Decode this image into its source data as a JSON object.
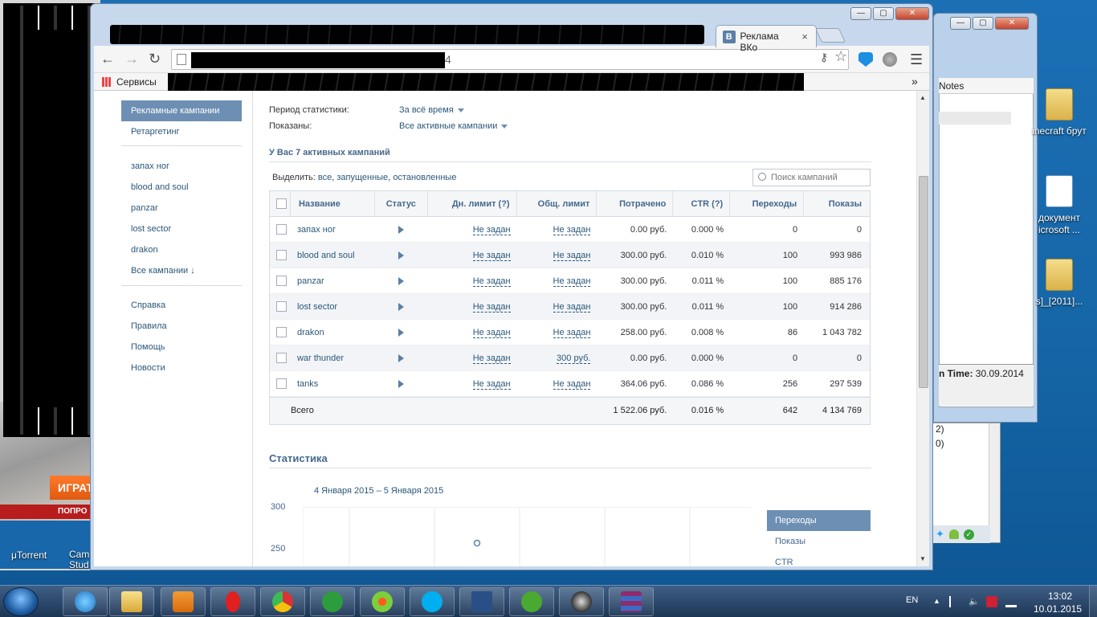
{
  "browser": {
    "active_tab_title": "Реклама ВКо",
    "address_suffix": "4",
    "bookmarks_label": "Сервисы",
    "bookmarks_more": "»"
  },
  "sidebar": {
    "main": [
      {
        "label": "Рекламные кампании",
        "active": true
      },
      {
        "label": "Ретаргетинг",
        "active": false
      }
    ],
    "campaigns": [
      "запах ног",
      "blood and soul",
      "panzar",
      "lost sector",
      "drakon",
      "Все кампании ↓"
    ],
    "help": [
      "Справка",
      "Правила",
      "Помощь",
      "Новости"
    ]
  },
  "filters": {
    "period_label": "Период статистики:",
    "period_value": "За всё время",
    "shown_label": "Показаны:",
    "shown_value": "Все активные кампании"
  },
  "campaigns_heading": "У Вас 7 активных кампаний",
  "select_line": {
    "prefix": "Выделить:",
    "all": "все",
    "running": "запущенные",
    "stopped": "остановленные"
  },
  "search_placeholder": "Поиск кампаний",
  "table": {
    "headers": [
      "Название",
      "Статус",
      "Дн. лимит (?)",
      "Общ. лимит",
      "Потрачено",
      "CTR (?)",
      "Переходы",
      "Показы"
    ],
    "rows": [
      {
        "name": "запах ног",
        "daily": "Не задан",
        "total": "Не задан",
        "spent": "0.00 руб.",
        "ctr": "0.000 %",
        "clicks": "0",
        "shows": "0"
      },
      {
        "name": "blood and soul",
        "daily": "Не задан",
        "total": "Не задан",
        "spent": "300.00 руб.",
        "ctr": "0.010 %",
        "clicks": "100",
        "shows": "993 986"
      },
      {
        "name": "panzar",
        "daily": "Не задан",
        "total": "Не задан",
        "spent": "300.00 руб.",
        "ctr": "0.011 %",
        "clicks": "100",
        "shows": "885 176"
      },
      {
        "name": "lost sector",
        "daily": "Не задан",
        "total": "Не задан",
        "spent": "300.00 руб.",
        "ctr": "0.011 %",
        "clicks": "100",
        "shows": "914 286"
      },
      {
        "name": "drakon",
        "daily": "Не задан",
        "total": "Не задан",
        "spent": "258.00 руб.",
        "ctr": "0.008 %",
        "clicks": "86",
        "shows": "1 043 782"
      },
      {
        "name": "war thunder",
        "daily": "Не задан",
        "total": "300 руб.",
        "spent": "0.00 руб.",
        "ctr": "0.000 %",
        "clicks": "0",
        "shows": "0"
      },
      {
        "name": "tanks",
        "daily": "Не задан",
        "total": "Не задан",
        "spent": "364.06 руб.",
        "ctr": "0.086 %",
        "clicks": "256",
        "shows": "297 539"
      }
    ],
    "total": {
      "label": "Всего",
      "spent": "1 522.06 руб.",
      "ctr": "0.016 %",
      "clicks": "642",
      "shows": "4 134 769"
    }
  },
  "stats": {
    "heading": "Статистика",
    "date_range": "4 Января 2015 – 5 Января 2015",
    "y_ticks": [
      "300",
      "250"
    ],
    "legend": [
      "Переходы",
      "Показы",
      "CTR"
    ]
  },
  "desktop": {
    "icons": [
      {
        "label": "inecraft брут",
        "kind": "folder"
      },
      {
        "label": "документ icrosoft ...",
        "kind": "doc"
      },
      {
        "label": "s]_[2011]...",
        "kind": "folder"
      }
    ],
    "left_labels": [
      "μTorrent",
      "Cam Stud"
    ],
    "left_game_button": "ИГРАТ",
    "left_game_strip": "ПОПРО",
    "back_window": {
      "notes": "Notes",
      "time_label": "n Time:",
      "time_value": "30.09.2014"
    },
    "small_panel": [
      "2)",
      "0)"
    ]
  },
  "taskbar": {
    "lang": "EN",
    "time": "13:02",
    "date": "10.01.2015"
  }
}
